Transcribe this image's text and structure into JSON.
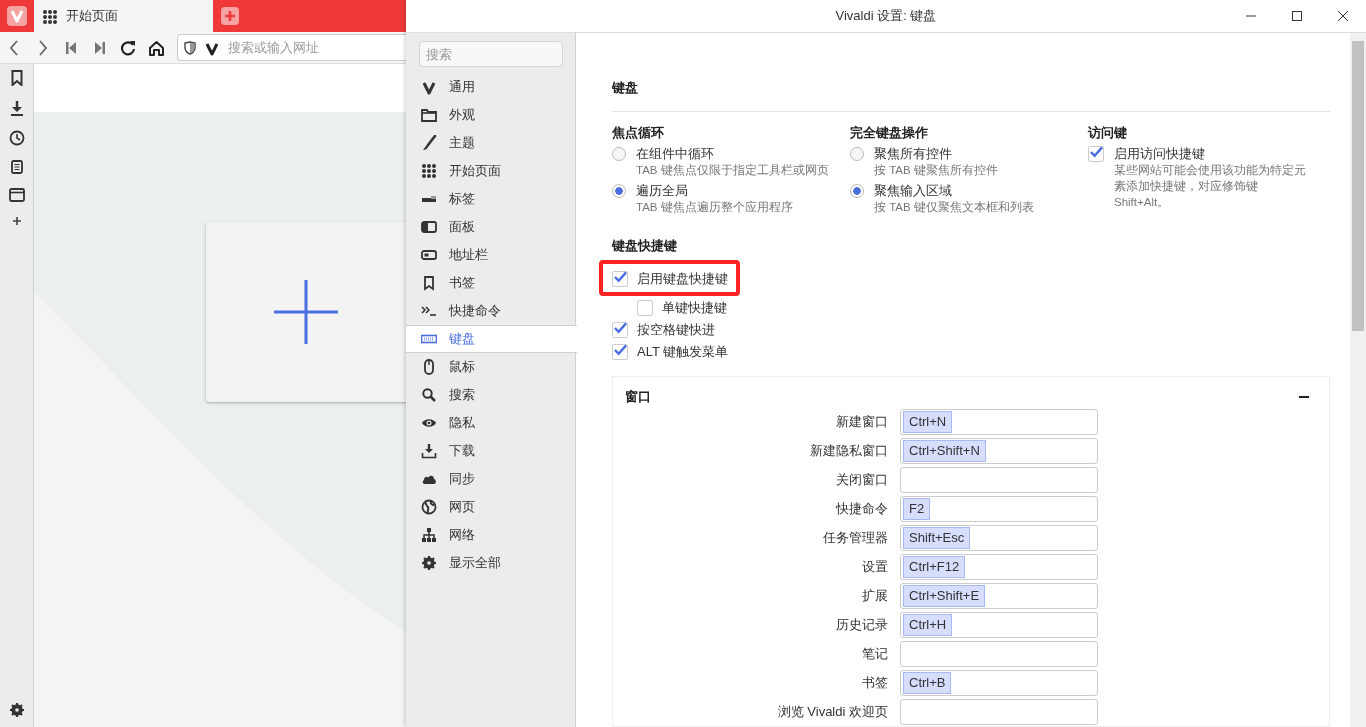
{
  "browser": {
    "tab": {
      "title": "开始页面"
    },
    "address_bar": {
      "placeholder": "搜索或输入网址"
    }
  },
  "settings_window": {
    "title": "Vivaldi 设置: 键盘"
  },
  "sidebar": {
    "search": {
      "placeholder": "搜索"
    },
    "items": [
      {
        "label": "通用",
        "selected": false
      },
      {
        "label": "外观",
        "selected": false
      },
      {
        "label": "主题",
        "selected": false
      },
      {
        "label": "开始页面",
        "selected": false
      },
      {
        "label": "标签",
        "selected": false
      },
      {
        "label": "面板",
        "selected": false
      },
      {
        "label": "地址栏",
        "selected": false
      },
      {
        "label": "书签",
        "selected": false
      },
      {
        "label": "快捷命令",
        "selected": false
      },
      {
        "label": "键盘",
        "selected": true
      },
      {
        "label": "鼠标",
        "selected": false
      },
      {
        "label": "搜索",
        "selected": false
      },
      {
        "label": "隐私",
        "selected": false
      },
      {
        "label": "下载",
        "selected": false
      },
      {
        "label": "同步",
        "selected": false
      },
      {
        "label": "网页",
        "selected": false
      },
      {
        "label": "网络",
        "selected": false
      },
      {
        "label": "显示全部",
        "selected": false
      }
    ]
  },
  "content": {
    "title": "键盘",
    "groups": [
      {
        "heading": "焦点循环",
        "kind": "radio",
        "options": [
          {
            "label": "在组件中循环",
            "hint": "TAB 键焦点仅限于指定工具栏或网页",
            "selected": false
          },
          {
            "label": "遍历全局",
            "hint": "TAB 键焦点遍历整个应用程序",
            "selected": true
          }
        ]
      },
      {
        "heading": "完全键盘操作",
        "kind": "radio",
        "options": [
          {
            "label": "聚焦所有控件",
            "hint": "按 TAB 键聚焦所有控件",
            "selected": false
          },
          {
            "label": "聚焦输入区域",
            "hint": "按 TAB 键仅聚焦文本框和列表",
            "selected": true
          }
        ]
      },
      {
        "heading": "访问键",
        "kind": "checkbox",
        "options": [
          {
            "label": "启用访问快捷键",
            "hint": "某些网站可能会使用该功能为特定元素添加快捷键，对应修饰键 Shift+Alt。",
            "checked": true
          }
        ]
      }
    ],
    "shortcuts": {
      "heading": "键盘快捷键",
      "options": [
        {
          "label": "启用键盘快捷键",
          "checked": true,
          "highlighted": true,
          "children": [
            {
              "label": "单键快捷键",
              "checked": false,
              "highlighted": false
            }
          ]
        },
        {
          "label": "按空格键快进",
          "checked": true,
          "highlighted": false
        },
        {
          "label": "ALT 键触发菜单",
          "checked": true,
          "highlighted": false
        }
      ]
    },
    "window_section": {
      "title": "窗口",
      "expanded": true,
      "rows": [
        {
          "label": "新建窗口",
          "keys": [
            "Ctrl+N"
          ]
        },
        {
          "label": "新建隐私窗口",
          "keys": [
            "Ctrl+Shift+N"
          ]
        },
        {
          "label": "关闭窗口",
          "keys": []
        },
        {
          "label": "快捷命令",
          "keys": [
            "F2"
          ]
        },
        {
          "label": "任务管理器",
          "keys": [
            "Shift+Esc"
          ]
        },
        {
          "label": "设置",
          "keys": [
            "Ctrl+F12"
          ]
        },
        {
          "label": "扩展",
          "keys": [
            "Ctrl+Shift+E"
          ]
        },
        {
          "label": "历史记录",
          "keys": [
            "Ctrl+H"
          ]
        },
        {
          "label": "笔记",
          "keys": []
        },
        {
          "label": "书签",
          "keys": [
            "Ctrl+B"
          ]
        },
        {
          "label": "浏览 Vivaldi 欢迎页",
          "keys": []
        }
      ]
    }
  }
}
